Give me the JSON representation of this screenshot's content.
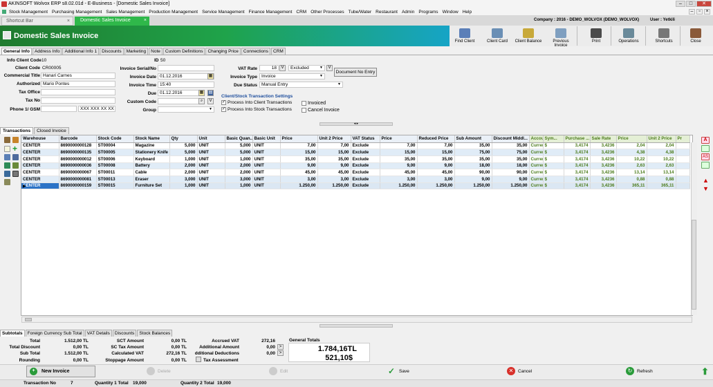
{
  "app": {
    "title": "AKINSOFT Wolvox ERP s8.02.01d - E-Business - [Domestic Sales Invoice]"
  },
  "menu": [
    "Stock Management",
    "Purchasing Management",
    "Sales Management",
    "Production Management",
    "Service Management",
    "Finance Management",
    "CRM",
    "Other Processes",
    "Tube/Water",
    "Restaurant",
    "Admin",
    "Programs",
    "Window",
    "Help"
  ],
  "doc_tabs": {
    "shortcut": "Shortcut Bar",
    "active": "Domestic Sales Invoice"
  },
  "header": {
    "title": "Domestic Sales Invoice",
    "company": "Company : 2016 - DEMO_WOLVOX (DEMO_WOLVOX)",
    "user": "User : Yetkili"
  },
  "toolbar": [
    "Find Client",
    "Client Card",
    "Client Balance",
    "Previous Invoice",
    "Print",
    "Operations",
    "Shortcuts",
    "Close"
  ],
  "form_tabs": [
    "General Info",
    "Address Info",
    "Additional Info 1",
    "Discounts",
    "Marketing",
    "Note",
    "Custom Definitions",
    "Changing Price",
    "Connections",
    "CRM"
  ],
  "form": {
    "info_client_code_label": "Info Client Code",
    "info_client_code": "10",
    "id_label": "ID",
    "id": "50",
    "client_code_label": "Client Code",
    "client_code": "CR00005",
    "commercial_title_label": "Commercial Title",
    "commercial_title": "Hanari Carnes",
    "authorized_label": "Authorized",
    "authorized": "Mario Pontes",
    "tax_office_label": "Tax Office",
    "tax_office": "",
    "tax_no_label": "Tax No",
    "tax_no": "",
    "phone_label": "Phone 1/ GSM",
    "phone": "",
    "gsm": "XXX XXX XX XX",
    "serial_label": "Invoice Serial/No",
    "serial": "",
    "date_label": "Invoice Date",
    "date": "01.12.2016",
    "time_label": "Invoice Time",
    "time": "15:40",
    "due_label": "Due",
    "due": "01.12.2016",
    "custom_code_label": "Custom Code",
    "custom_code": "",
    "group_label": "Group",
    "group": "",
    "vat_rate_label": "VAT Rate",
    "vat_rate": "18",
    "vat_mode": "Excluded",
    "invoice_type_label": "Invoice Type",
    "invoice_type": "Invoice",
    "due_status_label": "Due Status",
    "due_status": "Manual Entry",
    "doc_no_entry": "Document No Entry",
    "settings_title": "Client/Stock Transaction Settings",
    "process_client": "Process Into Client Transactions",
    "process_stock": "Process Into Stock Transactions",
    "invoiced": "Invoiced",
    "cancel_invoice": "Cancel Invoice"
  },
  "grid_tabs": [
    "Transactions",
    "Closed Invoice"
  ],
  "grid": {
    "columns": [
      "Warehouse",
      "Barcode",
      "Stock Code",
      "Stock Name",
      "Qty",
      "Unit",
      "Basic Quan...",
      "Basic Unit",
      "Price",
      "Unit 2 Price",
      "VAT Status",
      "Price",
      "Reduced Price",
      "Sub Amount",
      "Discount Middl...",
      "Account",
      "Sym...",
      "Purchase ...",
      "Sale Rate",
      "Price",
      "Unit 2 Price",
      "Pr"
    ],
    "rows": [
      [
        "CENTER",
        "8690000000128",
        "ST00004",
        "Magazine",
        "5,000",
        "UNIT",
        "5,000",
        "UNIT",
        "7,00",
        "7,00",
        "Exclude",
        "7,00",
        "7,00",
        "35,00",
        "35,00",
        "Currency",
        "$",
        "3,4174",
        "3,4236",
        "2,04",
        "2,04",
        ""
      ],
      [
        "CENTER",
        "8690000000135",
        "ST00005",
        "Stationery Knife",
        "5,000",
        "UNIT",
        "5,000",
        "UNIT",
        "15,00",
        "15,00",
        "Exclude",
        "15,00",
        "15,00",
        "75,00",
        "75,00",
        "Currency",
        "$",
        "3,4174",
        "3,4236",
        "4,38",
        "4,38",
        ""
      ],
      [
        "CENTER",
        "8690000000012",
        "ST00006",
        "Keyboard",
        "1,000",
        "UNIT",
        "1,000",
        "UNIT",
        "35,00",
        "35,00",
        "Exclude",
        "35,00",
        "35,00",
        "35,00",
        "35,00",
        "Currency",
        "$",
        "3,4174",
        "3,4236",
        "10,22",
        "10,22",
        ""
      ],
      [
        "CENTER",
        "8690000000036",
        "ST00008",
        "Battery",
        "2,000",
        "UNIT",
        "2,000",
        "UNIT",
        "9,00",
        "9,00",
        "Exclude",
        "9,00",
        "9,00",
        "18,00",
        "18,00",
        "Currency",
        "$",
        "3,4174",
        "3,4236",
        "2,63",
        "2,63",
        ""
      ],
      [
        "CENTER",
        "8690000000067",
        "ST00011",
        "Cable",
        "2,000",
        "UNIT",
        "2,000",
        "UNIT",
        "45,00",
        "45,00",
        "Exclude",
        "45,00",
        "45,00",
        "90,00",
        "90,00",
        "Currency",
        "$",
        "3,4174",
        "3,4236",
        "13,14",
        "13,14",
        ""
      ],
      [
        "CENTER",
        "8690000000081",
        "ST00013",
        "Eraser",
        "3,000",
        "UNIT",
        "3,000",
        "UNIT",
        "3,00",
        "3,00",
        "Exclude",
        "3,00",
        "3,00",
        "9,00",
        "9,00",
        "Currency",
        "$",
        "3,4174",
        "3,4236",
        "0,88",
        "0,88",
        ""
      ],
      [
        "CENTER",
        "8690000000159",
        "ST00015",
        "Furniture Set",
        "1,000",
        "UNIT",
        "1,000",
        "UNIT",
        "1.250,00",
        "1.250,00",
        "Exclude",
        "1.250,00",
        "1.250,00",
        "1.250,00",
        "1.250,00",
        "Currency",
        "$",
        "3,4174",
        "3,4236",
        "365,11",
        "365,11",
        ""
      ]
    ]
  },
  "sub_tabs": [
    "Subtotals",
    "Foreign Currency Sub Total",
    "VAT Details",
    "Discounts",
    "Stock Balances"
  ],
  "totals": {
    "total_label": "Total",
    "total": "1.512,00 TL",
    "total_discount_label": "Total Discount",
    "total_discount": "0,00 TL",
    "sub_total_label": "Sub Total",
    "sub_total": "1.512,00 TL",
    "rounding_label": "Rounding",
    "rounding": "0,00 TL",
    "sct_amount_label": "SCT Amount",
    "sct_amount": "0,00 TL",
    "sc_tax_label": "SC Tax Amount",
    "sc_tax": "0,00 TL",
    "calc_vat_label": "Calculated VAT",
    "calc_vat": "272,16 TL",
    "stoppage_label": "Stoppage Amount",
    "stoppage": "0,00 TL",
    "accrued_vat_label": "Accrued VAT",
    "accrued_vat": "272,16",
    "additional_amount_label": "Additional Amount",
    "additional_amount": "0,00",
    "additional_ded_label": "dditional Deductions",
    "additional_ded": "0,00",
    "tax_assessment_label": "Tax Assessment",
    "general_totals_label": "General Totals",
    "general_tl": "1.784,16TL",
    "general_usd": "521,10$"
  },
  "actions": {
    "new_invoice": "New Invoice",
    "delete": "Delete",
    "edit": "Edit",
    "save": "Save",
    "cancel": "Cancel",
    "refresh": "Refresh"
  },
  "status": {
    "txn_no_label": "Transaction No",
    "txn_no": "7",
    "qty1_label": "Quantity 1 Total",
    "qty1": "19,000",
    "qty2_label": "Quantity 2 Total",
    "qty2": "19,000"
  },
  "colors": {
    "accent_green": "#2fb84a",
    "header_teal": "#16a4c6",
    "selected_blue": "#2b73c7",
    "currency_green": "#4a7a19"
  }
}
